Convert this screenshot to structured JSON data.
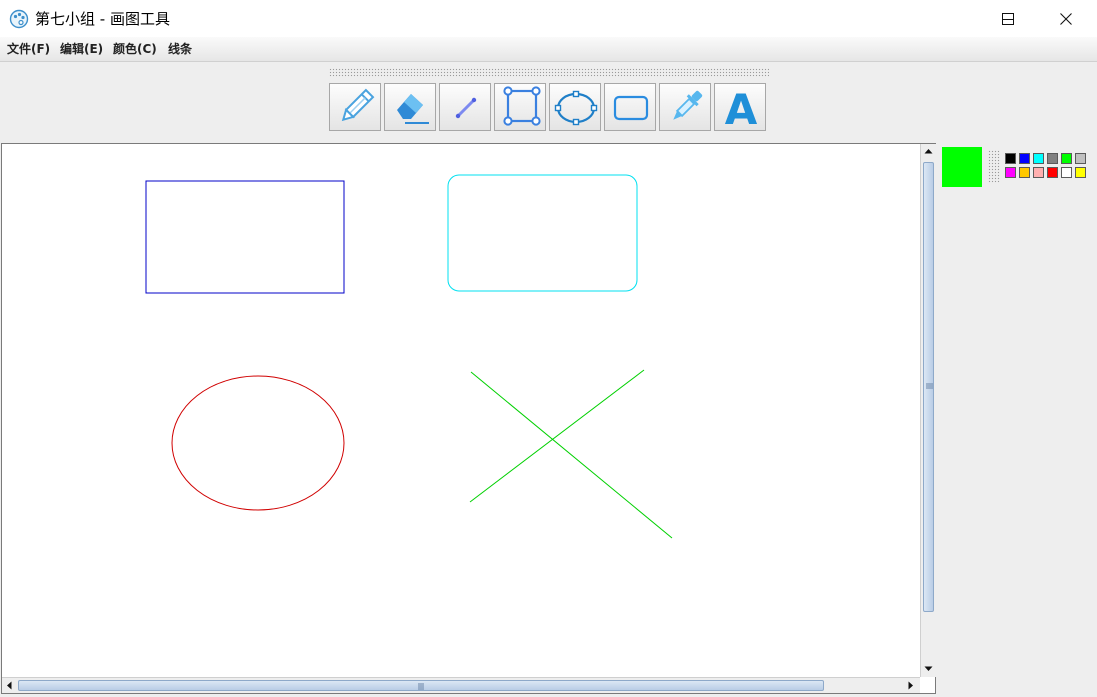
{
  "window": {
    "title": "第七小组 - 画图工具",
    "app_icon": "palette-icon",
    "controls": [
      "minimize-icon",
      "maximize-icon",
      "close-icon"
    ]
  },
  "menu": {
    "items": [
      {
        "label": "文件(F)"
      },
      {
        "label": "编辑(E)"
      },
      {
        "label": "颜色(C)"
      },
      {
        "label": "线条"
      }
    ]
  },
  "toolbar": {
    "tools": [
      {
        "name": "pencil",
        "icon": "pencil-icon"
      },
      {
        "name": "eraser",
        "icon": "eraser-icon"
      },
      {
        "name": "line",
        "icon": "line-icon"
      },
      {
        "name": "rectangle",
        "icon": "rectangle-icon"
      },
      {
        "name": "ellipse",
        "icon": "ellipse-icon"
      },
      {
        "name": "rounded-rectangle",
        "icon": "rounded-rectangle-icon"
      },
      {
        "name": "color-picker",
        "icon": "eyedropper-icon"
      },
      {
        "name": "text",
        "icon": "text-icon",
        "glyph": "A"
      }
    ]
  },
  "canvas": {
    "shapes": [
      {
        "type": "rectangle",
        "color": "#0000c8"
      },
      {
        "type": "rounded-rectangle",
        "color": "#00e0f0"
      },
      {
        "type": "ellipse",
        "color": "#d00000"
      },
      {
        "type": "line",
        "color": "#00d000"
      },
      {
        "type": "line",
        "color": "#00d000"
      }
    ]
  },
  "colors": {
    "current": "#00ff00",
    "palette": [
      "#000000",
      "#0000ff",
      "#00ffff",
      "#808080",
      "#00ff00",
      "#c0c0c0",
      "#ff00ff",
      "#ffc800",
      "#ffafaf",
      "#ff0000",
      "#ffffff",
      "#ffff00"
    ]
  }
}
